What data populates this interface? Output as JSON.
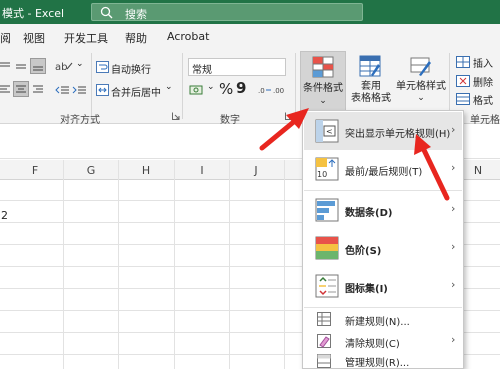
{
  "window": {
    "title": "模式 - Excel"
  },
  "search": {
    "label": "搜索"
  },
  "menu": {
    "tabs": [
      {
        "label": "阅"
      },
      {
        "label": "视图"
      },
      {
        "label": "开发工具"
      },
      {
        "label": "帮助"
      },
      {
        "label": "Acrobat"
      }
    ]
  },
  "ribbon": {
    "alignment": {
      "wrap_text": "自动换行",
      "merge_center": "合并后居中",
      "group_label": "对齐方式"
    },
    "number": {
      "format_value": "常规",
      "percent": "%",
      "comma": "9",
      "group_label": "数字"
    },
    "styles": {
      "conditional_format": "条件格式",
      "table_line1": "套用",
      "table_line2": "表格格式",
      "cell_styles": "单元格样式"
    },
    "cells": {
      "insert": "插入",
      "delete": "删除",
      "format": "格式",
      "group_label": "单元格"
    }
  },
  "grid": {
    "columns": [
      "F",
      "G",
      "H",
      "I",
      "J",
      "N"
    ],
    "visible_value": "2"
  },
  "conditional_menu": {
    "items": [
      {
        "label": "突出显示单元格规则(H)"
      },
      {
        "label": "最前/最后规则(T)"
      },
      {
        "label": "数据条(D)"
      },
      {
        "label": "色阶(S)"
      },
      {
        "label": "图标集(I)"
      },
      {
        "label": "新建规则(N)..."
      },
      {
        "label": "清除规则(C)"
      },
      {
        "label": "管理规则(R)..."
      }
    ]
  },
  "colors": {
    "excel_green": "#217346",
    "annotation_red": "#e8261f",
    "menu_highlight": "#e6e6e6"
  }
}
